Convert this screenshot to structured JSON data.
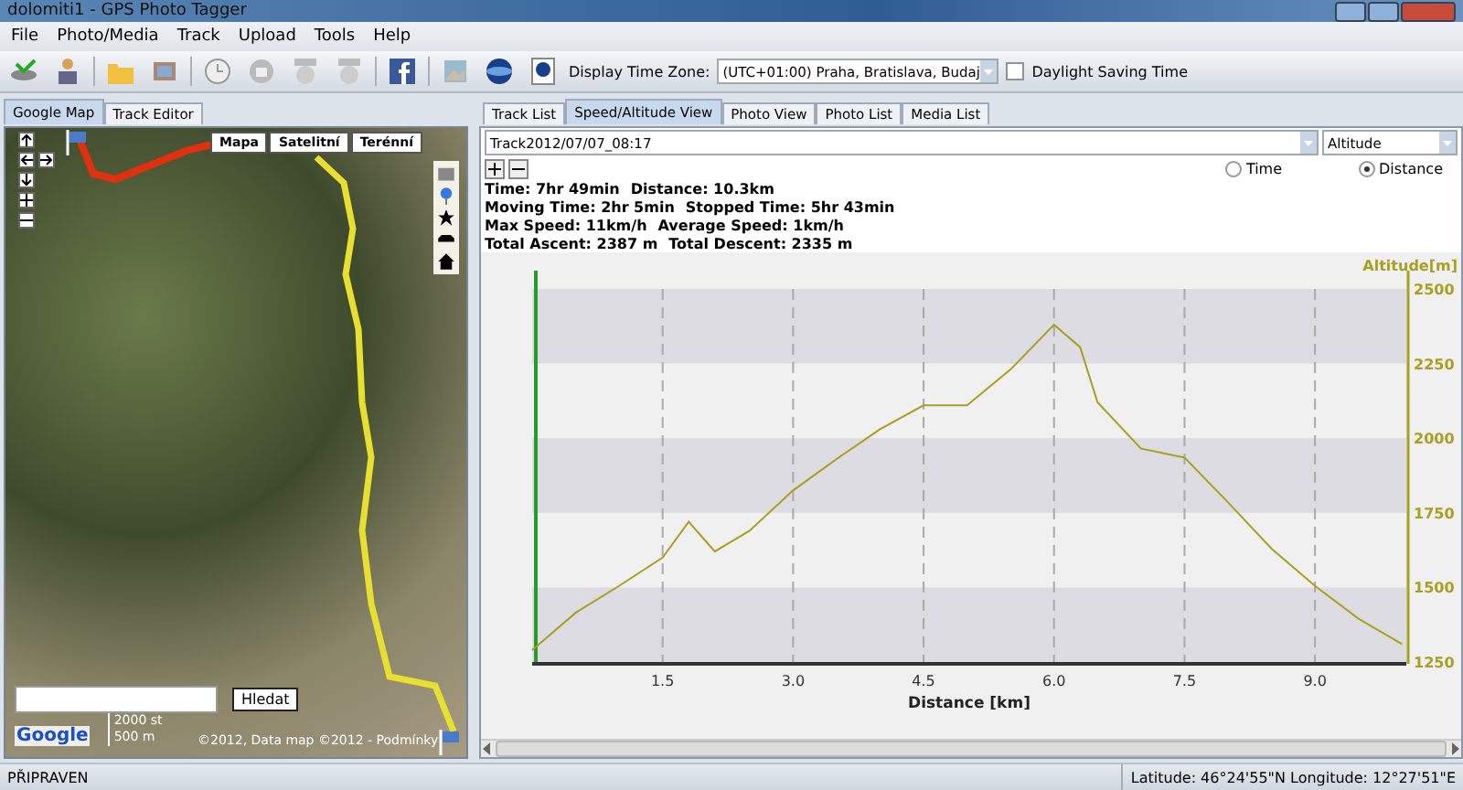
{
  "window": {
    "title": "dolomiti1 - GPS Photo Tagger"
  },
  "menu": [
    "File",
    "Photo/Media",
    "Track",
    "Upload",
    "Tools",
    "Help"
  ],
  "toolbar": {
    "timezone_label": "Display Time Zone:",
    "timezone_value": "(UTC+01:00) Praha, Bratislava, Budaj",
    "daylight_saving": {
      "label": "Daylight Saving Time",
      "checked": false
    }
  },
  "left_tabs": [
    {
      "label": "Google Map",
      "selected": true
    },
    {
      "label": "Track Editor",
      "selected": false
    }
  ],
  "map": {
    "map_types": [
      "Mapa",
      "Satelitní",
      "Terénní"
    ],
    "search": {
      "button": "Hledat"
    },
    "scale": [
      "2000 st",
      "500 m"
    ],
    "logo": "Google",
    "attribution": "©2012, Data map ©2012 - Podmínky"
  },
  "right_tabs": [
    {
      "label": "Track List",
      "selected": false
    },
    {
      "label": "Speed/Altitude View",
      "selected": true
    },
    {
      "label": "Photo View",
      "selected": false
    },
    {
      "label": "Photo List",
      "selected": false
    },
    {
      "label": "Media List",
      "selected": false
    }
  ],
  "track_select": "Track2012/07/07_08:17",
  "measure_select": "Altitude",
  "axis_mode": [
    {
      "label": "Time",
      "selected": false
    },
    {
      "label": "Distance",
      "selected": true
    }
  ],
  "stats": [
    [
      "Time: 7hr 49min",
      "Distance: 10.3km"
    ],
    [
      "Moving Time: 2hr 5min",
      "Stopped Time: 5hr 43min"
    ],
    [
      "Max Speed: 11km/h",
      "Average Speed: 1km/h"
    ],
    [
      "Total Ascent: 2387 m",
      "Total Descent: 2335 m"
    ]
  ],
  "chart_data": {
    "type": "line",
    "xlabel": "Distance [km]",
    "ylabel": "Altitude[m]",
    "x": [
      0,
      0.5,
      1.0,
      1.5,
      1.8,
      2.1,
      2.5,
      3.0,
      3.5,
      4.0,
      4.5,
      5.0,
      5.5,
      6.0,
      6.3,
      6.5,
      7.0,
      7.5,
      8.0,
      8.5,
      9.0,
      9.5,
      10.0
    ],
    "series": [
      {
        "color": "#a8a020",
        "values": [
          1290,
          1415,
          1505,
          1600,
          1720,
          1620,
          1690,
          1825,
          1930,
          2030,
          2110,
          2110,
          2230,
          2380,
          2305,
          2120,
          1965,
          1935,
          1785,
          1630,
          1505,
          1395,
          1310
        ]
      }
    ],
    "xlim": [
      0,
      10.05
    ],
    "ylim": [
      1250,
      2500
    ],
    "xticks": [
      {
        "value": 1.5,
        "label": "1.5"
      },
      {
        "value": 3,
        "label": "3.0"
      },
      {
        "value": 4.5,
        "label": "4.5"
      },
      {
        "value": 6,
        "label": "6.0"
      },
      {
        "value": 7.5,
        "label": "7.5"
      },
      {
        "value": 9,
        "label": "9.0"
      }
    ],
    "yticks": [
      1250,
      1500,
      1750,
      2000,
      2250,
      2500
    ],
    "grid": true
  },
  "status_bar": {
    "state": "PŘIPRAVEN",
    "position": "Latitude: 46°24'55\"N  Longitude: 12°27'51\"E"
  }
}
